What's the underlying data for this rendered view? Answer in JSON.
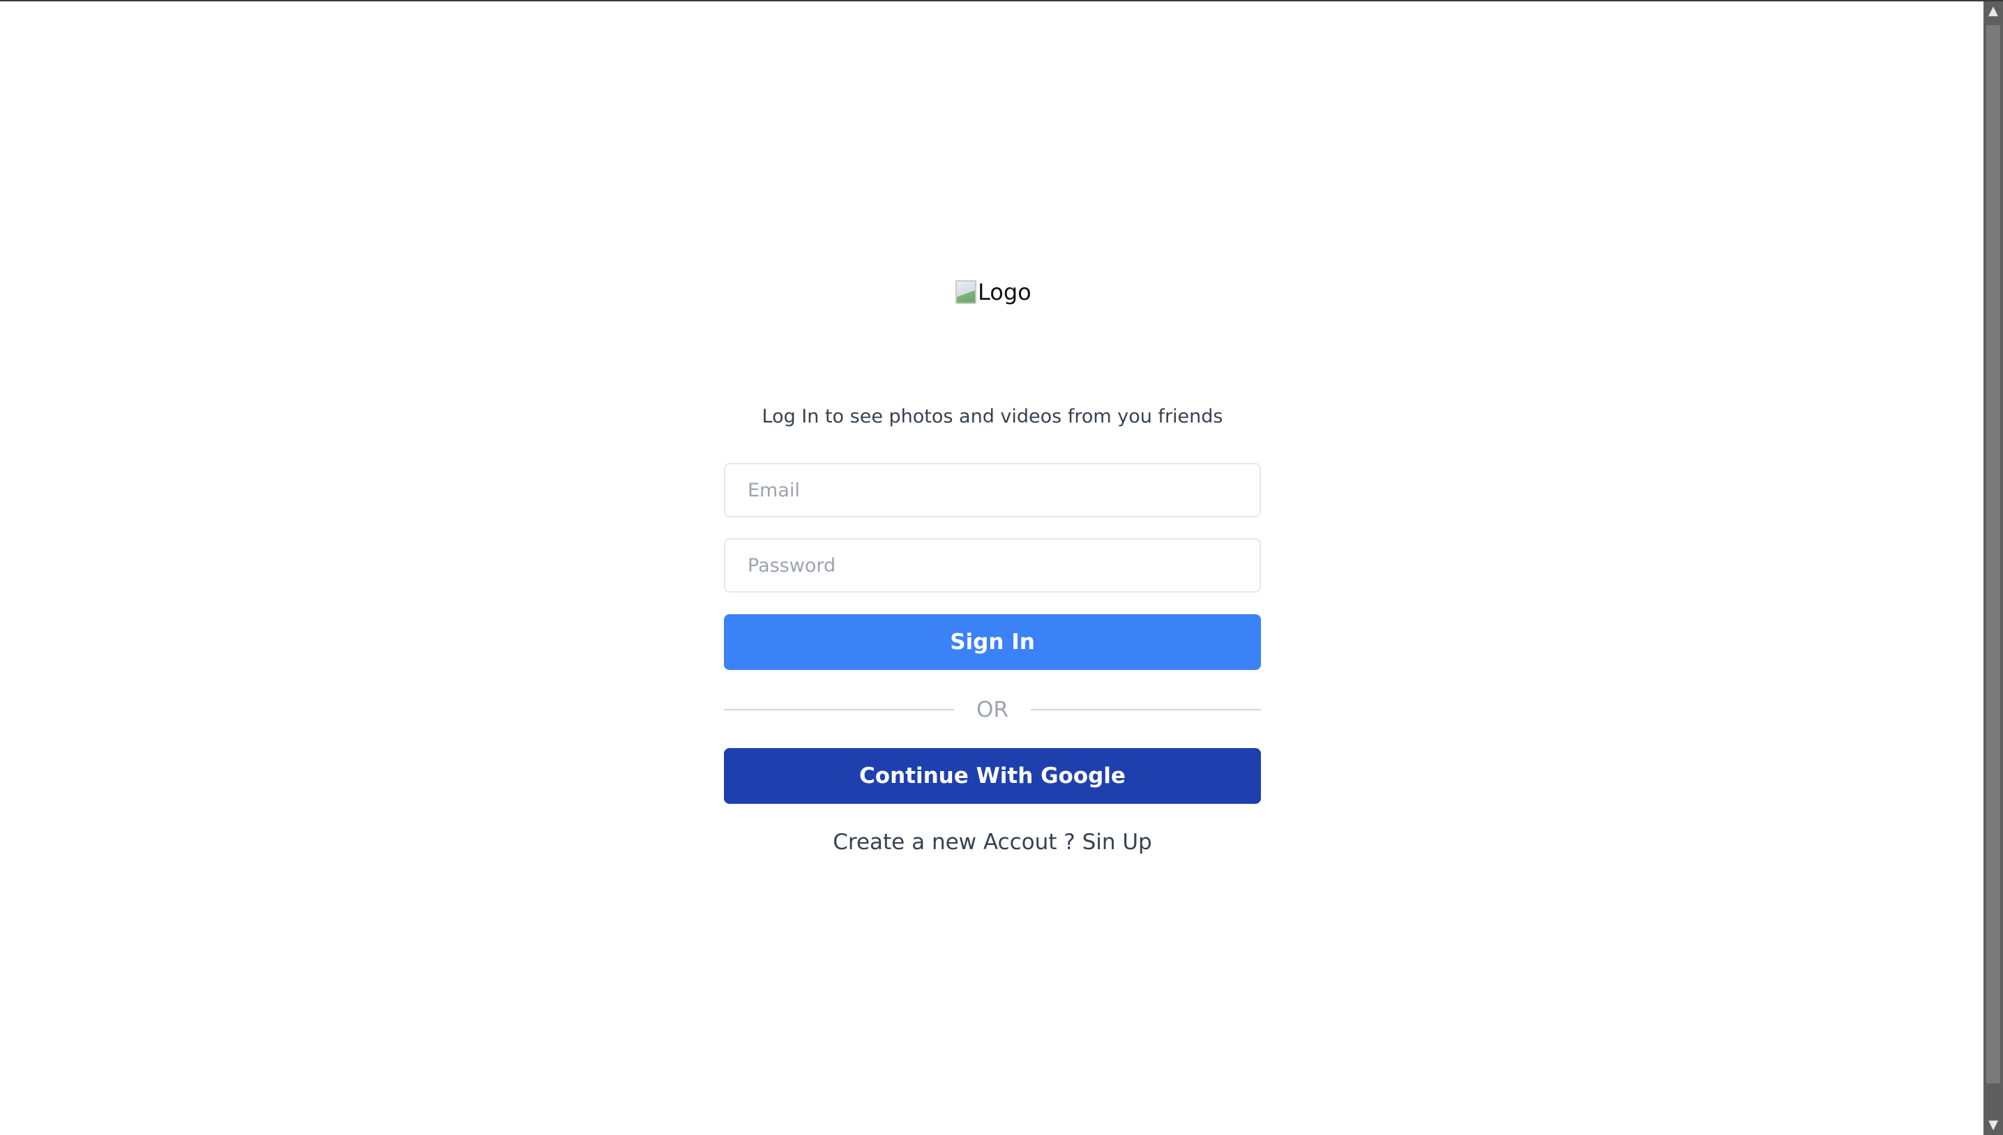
{
  "logo": {
    "alt_text": "Logo"
  },
  "login": {
    "tagline": "Log In to see photos and videos from you friends",
    "email_placeholder": "Email",
    "password_placeholder": "Password",
    "email_value": "",
    "password_value": "",
    "signin_label": "Sign In",
    "or_label": "OR",
    "google_label": "Continue With Google",
    "signup_prompt": "Create a new Accout ? ",
    "signup_link": "Sin Up"
  },
  "colors": {
    "primary": "#3b82f6",
    "google_button": "#1e40af",
    "text": "#374151",
    "muted": "#9ca3af",
    "border": "#e5e7eb"
  },
  "icons": {
    "logo": "broken-image-icon",
    "scroll_up": "scroll-up-arrow-icon",
    "scroll_down": "scroll-down-arrow-icon"
  }
}
